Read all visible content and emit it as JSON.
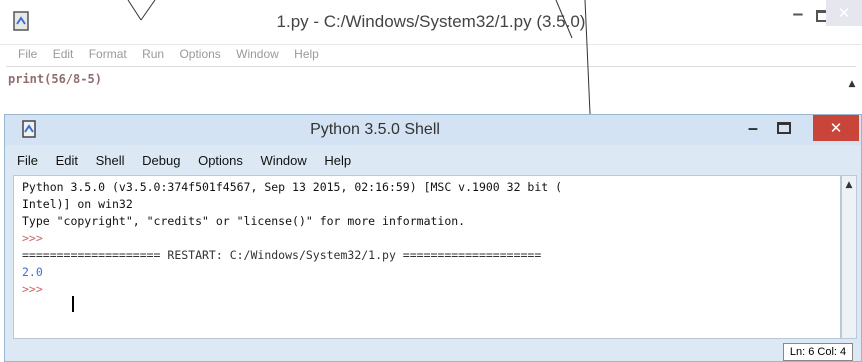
{
  "editor": {
    "title": "1.py - C:/Windows/System32/1.py (3.5.0)",
    "menu": [
      "File",
      "Edit",
      "Format",
      "Run",
      "Options",
      "Window",
      "Help"
    ],
    "code": "print(56/8-5)"
  },
  "shell": {
    "title": "Python 3.5.0 Shell",
    "menu": [
      "File",
      "Edit",
      "Shell",
      "Debug",
      "Options",
      "Window",
      "Help"
    ],
    "lines": [
      "Python 3.5.0 (v3.5.0:374f501f4567, Sep 13 2015, 02:16:59) [MSC v.1900 32 bit (",
      "Intel)] on win32",
      "Type \"copyright\", \"credits\" or \"license()\" for more information.",
      ">>>",
      "==================== RESTART: C:/Windows/System32/1.py ====================",
      "2.0",
      ">>> "
    ],
    "status": "Ln: 6 Col: 4"
  },
  "colors": {
    "prompt": "#c86a6a",
    "output": "#3b6fd0",
    "restart": "#333333",
    "close_red": "#c9453a"
  }
}
